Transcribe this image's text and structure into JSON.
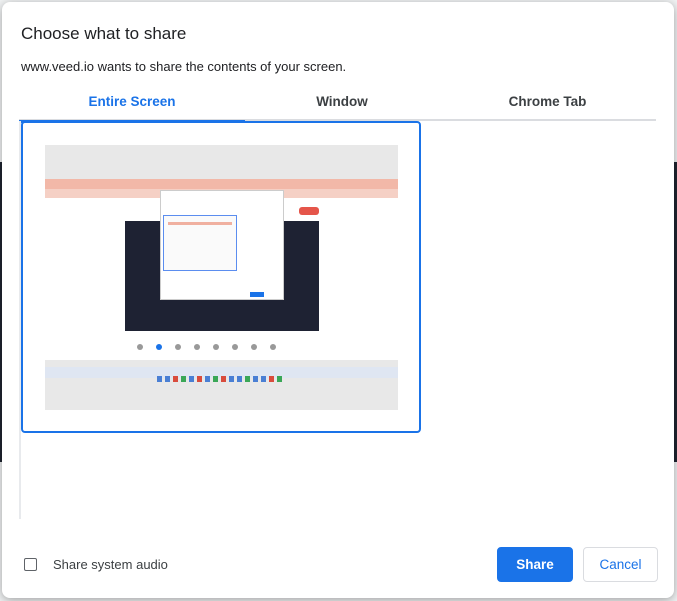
{
  "dialog": {
    "title": "Choose what to share",
    "subtitle": "www.veed.io wants to share the contents of your screen."
  },
  "tabs": [
    {
      "label": "Entire Screen",
      "active": true
    },
    {
      "label": "Window",
      "active": false
    },
    {
      "label": "Chrome Tab",
      "active": false
    }
  ],
  "footer": {
    "audio_label": "Share system audio",
    "audio_checked": false,
    "share_label": "Share",
    "cancel_label": "Cancel"
  },
  "colors": {
    "accent": "#1a73e8"
  }
}
